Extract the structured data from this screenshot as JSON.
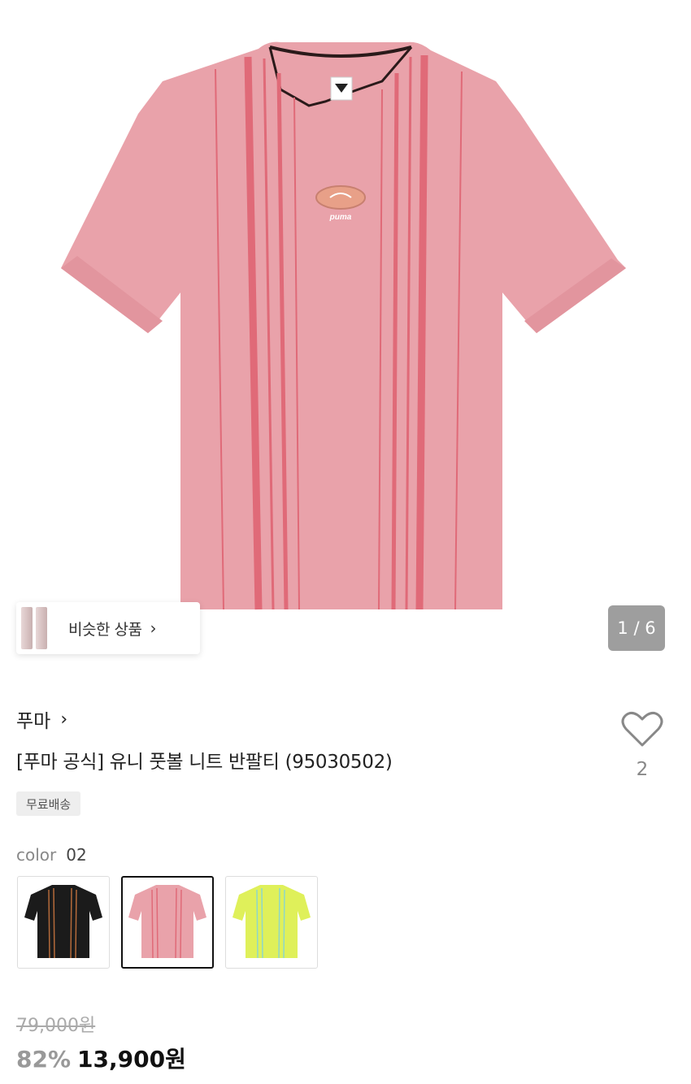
{
  "gallery": {
    "similar_label": "비슷한 상품",
    "chevron": "chevron-right-icon",
    "counter": "1 / 6",
    "main_image": "pink-football-tshirt-photo",
    "product_logo_text": "puma"
  },
  "product": {
    "brand": "푸마",
    "brand_chevron": "chevron-right-icon",
    "title": "[푸마 공식] 유니 풋볼 니트 반팔티 (95030502)",
    "likes": "2",
    "heart_icon": "heart-outline-icon",
    "badge": "무료배송"
  },
  "color": {
    "label": "color",
    "value": "02",
    "options": [
      {
        "name": "black",
        "selected": false,
        "color": "#1b1b1b"
      },
      {
        "name": "pink",
        "selected": true,
        "color": "#e8a3ab"
      },
      {
        "name": "lime",
        "selected": false,
        "color": "#dff05a"
      }
    ]
  },
  "price": {
    "original": "79,000원",
    "discount": "82%",
    "sale": "13,900원"
  },
  "colors": {
    "shirt_pink": "#e9a2aa",
    "stripe": "#e06a78",
    "counter_bg": "#9e9e9e"
  }
}
